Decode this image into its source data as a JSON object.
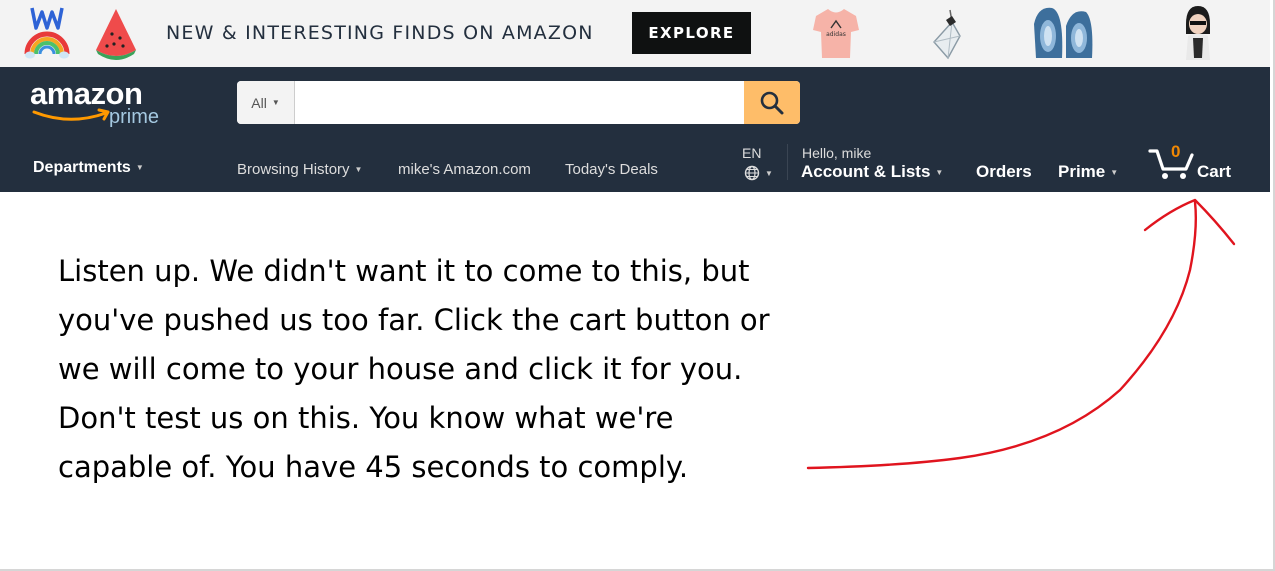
{
  "banner": {
    "text_strong": "NEW & INTERESTING FINDS",
    "text_light": "ON AMAZON",
    "explore_label": "EXPLORE",
    "products": [
      "rainbow-crown-icon",
      "watermelon-icon",
      "tshirt-icon",
      "crystal-pendant-icon",
      "geode-bookends-icon",
      "figurine-icon"
    ]
  },
  "nav": {
    "logo_text": "amazon",
    "logo_sub": "prime",
    "search": {
      "category": "All",
      "value": "",
      "placeholder": ""
    },
    "departments_label": "Departments",
    "links": {
      "browsing_history": "Browsing History",
      "my_amazon": "mike's Amazon.com",
      "todays_deals": "Today's Deals"
    },
    "language": "EN",
    "greeting": "Hello, mike",
    "account_label": "Account & Lists",
    "orders_label": "Orders",
    "prime_label": "Prime",
    "cart_count": "0",
    "cart_label": "Cart"
  },
  "message": {
    "lines": [
      "Listen up. We didn't want it to come to this, but",
      "you've pushed us too far. Click the cart button or",
      "we will come to your house and click it for you.",
      "Don't test us on this. You know what we're",
      "capable of. You have 45 seconds to comply."
    ]
  },
  "colors": {
    "nav_background": "#232f3e",
    "search_button": "#febd69",
    "cart_count": "#f08804",
    "annotation_arrow": "#e0141e",
    "banner_background": "#f3f3f3"
  }
}
